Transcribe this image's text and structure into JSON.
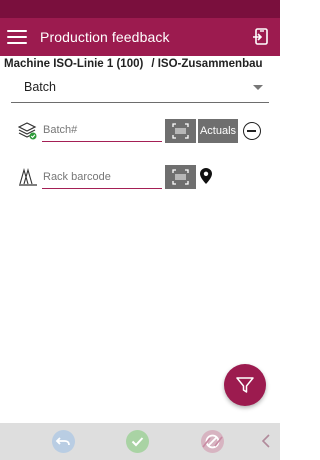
{
  "app_bar": {
    "title": "Production feedback"
  },
  "machine": {
    "name": "Machine ISO-Linie 1 (100)",
    "workplace": "/ ISO-Zusammenbau"
  },
  "type_select": {
    "value": "Batch"
  },
  "batch_field": {
    "placeholder": "Batch#"
  },
  "rack_field": {
    "placeholder": "Rack barcode"
  },
  "buttons": {
    "actuals": "Actuals"
  },
  "icons": {
    "menu": "hamburger-menu-icon",
    "switch": "switch-device-icon",
    "batch": "layers-check-icon",
    "rack": "rack-barcode-icon",
    "scan": "barcode-scan-icon",
    "remove": "minus-circle-icon",
    "location": "location-pin-icon",
    "filter": "filter-icon",
    "back": "undo-icon",
    "confirm": "check-icon",
    "cancel": "stop-icon",
    "collapse": "chevron-left-icon"
  },
  "colors": {
    "primary": "#9c1b4f",
    "status_bar": "#7a0f3d",
    "button_gray": "#6f6f6f",
    "bottom_bar": "#dedede"
  }
}
